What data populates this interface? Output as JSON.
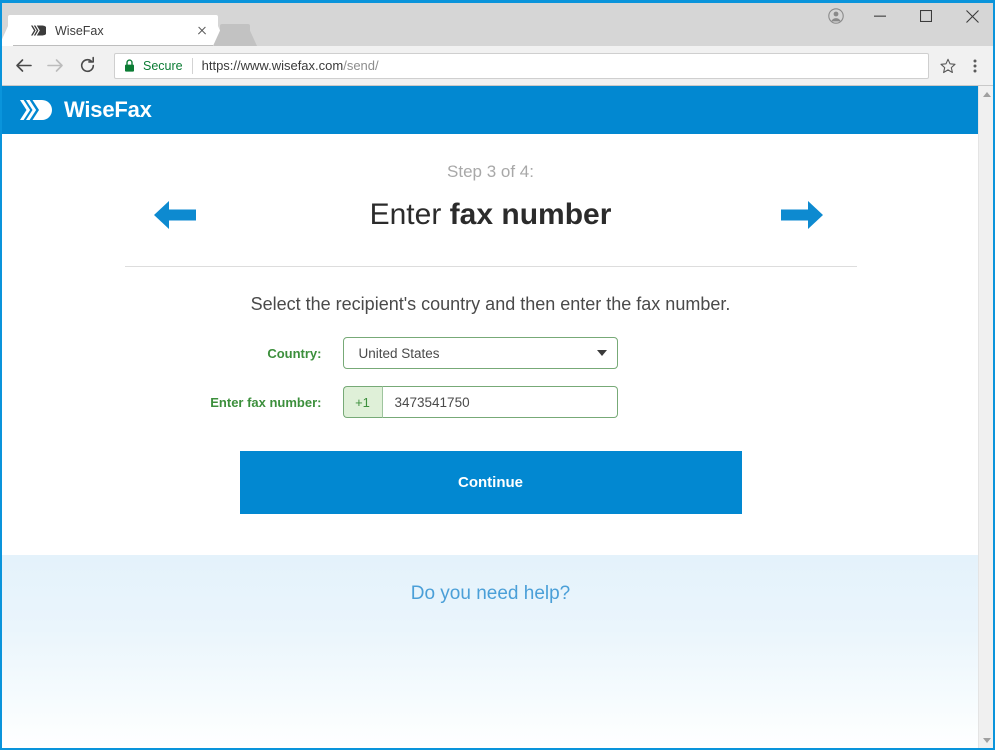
{
  "browser": {
    "tab": {
      "title": "WiseFax",
      "favicon_icon": "wisefax-chevrons-icon",
      "close_icon": "close-icon"
    },
    "new_tab_icon": "new-tab-icon",
    "window_controls": {
      "account_icon": "account-avatar-icon",
      "minimize_icon": "minimize-icon",
      "maximize_icon": "maximize-icon",
      "close_icon": "window-close-icon"
    },
    "nav": {
      "back_icon": "back-arrow-icon",
      "forward_icon": "forward-arrow-icon",
      "reload_icon": "reload-icon"
    },
    "omnibox": {
      "lock_icon": "padlock-icon",
      "security_label": "Secure",
      "url_host": "https://www.wisefax.com",
      "url_path": "/send/",
      "url_full": "https://www.wisefax.com/send/",
      "star_icon": "bookmark-star-icon",
      "menu_icon": "three-dot-menu-icon"
    }
  },
  "site": {
    "brand_name": "WiseFax",
    "brand_icon": "wisefax-chevrons-icon",
    "header_color": "#0288d1"
  },
  "main": {
    "step_label": "Step 3 of 4:",
    "title_light": "Enter",
    "title_bold": "fax number",
    "prev_icon": "arrow-left-icon",
    "next_icon": "arrow-right-icon",
    "instruction": "Select the recipient's country and then enter the fax number.",
    "form": {
      "country": {
        "label": "Country:",
        "value": "United States",
        "caret_icon": "chevron-down-icon"
      },
      "fax": {
        "label": "Enter fax number:",
        "prefix": "+1",
        "value": "3473541750",
        "placeholder": ""
      }
    },
    "continue_label": "Continue"
  },
  "footer": {
    "help_link": "Do you need help?",
    "background_color": "#e4f2fb",
    "link_color": "#4a9fd8"
  },
  "scrollbar": {
    "up_icon": "scroll-up-arrow-icon",
    "down_icon": "scroll-down-arrow-icon"
  },
  "colors": {
    "accent_blue": "#0288d1",
    "form_green": "#3c8f3c",
    "prefix_green_bg": "#dff0d8",
    "secure_green": "#0b7c34"
  }
}
